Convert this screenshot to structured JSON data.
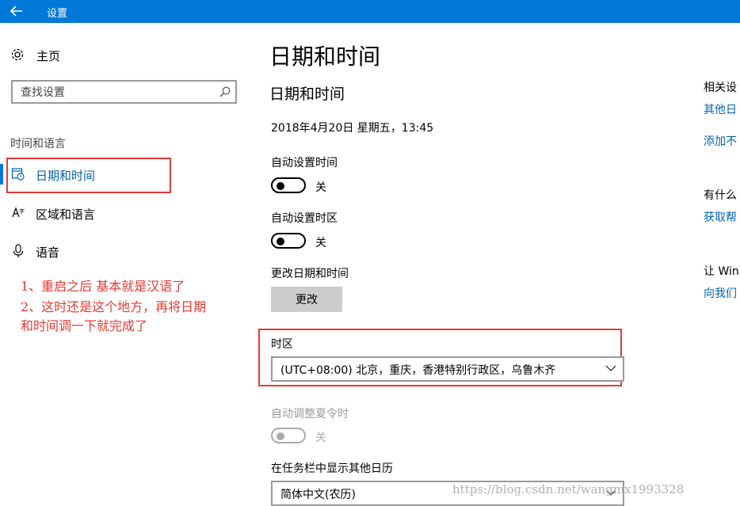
{
  "window": {
    "title": "设置"
  },
  "sidebar": {
    "home_label": "主页",
    "search_placeholder": "查找设置",
    "section_label": "时间和语言",
    "items": [
      {
        "label": "日期和时间",
        "icon": "calendar-clock-icon",
        "active": true
      },
      {
        "label": "区域和语言",
        "icon": "region-language-icon",
        "active": false
      },
      {
        "label": "语音",
        "icon": "microphone-icon",
        "active": false
      }
    ]
  },
  "annotation": {
    "lines": [
      "1、重启之后  基本就是汉语了",
      "2、这时还是这个地方，再将日期",
      "和时间调一下就完成了"
    ],
    "color": "#e53935"
  },
  "main": {
    "page_title": "日期和时间",
    "section_title": "日期和时间",
    "current_datetime": "2018年4月20日 星期五，13:45",
    "auto_time": {
      "label": "自动设置时间",
      "state": "关"
    },
    "auto_timezone": {
      "label": "自动设置时区",
      "state": "关"
    },
    "change_datetime": {
      "label": "更改日期和时间",
      "button": "更改"
    },
    "timezone": {
      "label": "时区",
      "value": "(UTC+08:00) 北京，重庆，香港特别行政区，乌鲁木齐"
    },
    "auto_dst": {
      "label": "自动调整夏令时",
      "state": "关"
    },
    "taskbar_calendar": {
      "label": "在任务栏中显示其他日历",
      "value": "简体中文(农历)"
    }
  },
  "right_column": {
    "related_heading": "相关设",
    "link_other": "其他日",
    "link_add": "添加不",
    "question_heading": "有什么",
    "link_help": "获取帮",
    "win_heading": "让 Win",
    "link_feedback": "向我们"
  },
  "watermark": "https://blog.csdn.net/wangmx1993328",
  "colors": {
    "accent": "#0078d7",
    "link": "#0063b1",
    "annotation": "#e53935"
  }
}
